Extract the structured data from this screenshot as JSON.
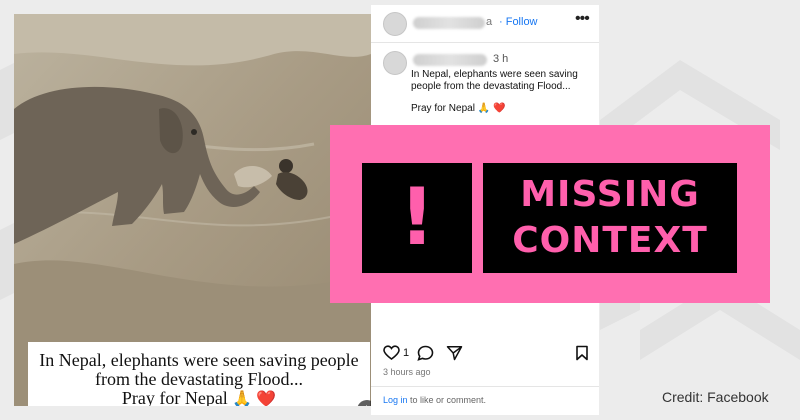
{
  "video": {
    "caption_line1": "In Nepal, elephants were seen saving people",
    "caption_line2": "from the devastating Flood...",
    "caption_line3_text": "Pray for Nepal",
    "caption_line3_emoji": "🙏 ❤️",
    "mute_icon": "speaker-muted-icon"
  },
  "post": {
    "header": {
      "name_suffix": "a",
      "follow_label": "· Follow",
      "more_icon": "•••"
    },
    "comment": {
      "time": "3 h",
      "line1": "In Nepal, elephants were seen saving",
      "line2": "people from the devastating Flood...",
      "line3_text": "Pray for Nepal",
      "line3_emoji": "🙏",
      "line3_heart": "❤️"
    },
    "actions": {
      "like_count": "1"
    },
    "posted_time": "3 hours ago",
    "login_link": "Log in",
    "login_rest": " to like or comment."
  },
  "banner": {
    "symbol": "!",
    "line1": "MISSING",
    "line2": "CONTEXT",
    "color": "#ff6fb1"
  },
  "credit": "Credit: Facebook"
}
